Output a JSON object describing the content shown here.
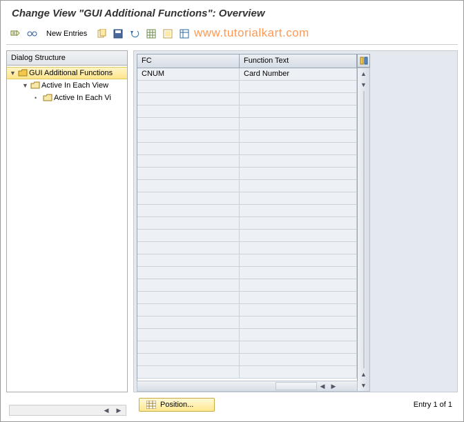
{
  "title": "Change View \"GUI Additional Functions\": Overview",
  "toolbar": {
    "new_entries": "New Entries"
  },
  "watermark": "www.tutorialkart.com",
  "tree": {
    "header": "Dialog Structure",
    "nodes": [
      {
        "label": "GUI Additional Functions",
        "selected": true
      },
      {
        "label": "Active In Each View"
      },
      {
        "label": "Active In Each Vi"
      }
    ]
  },
  "grid": {
    "columns": [
      "FC",
      "Function Text"
    ],
    "rows": [
      {
        "fc": "CNUM",
        "ft": "Card Number"
      }
    ]
  },
  "position_btn": "Position...",
  "status": "Entry 1 of 1",
  "chart_data": {
    "type": "table",
    "columns": [
      "FC",
      "Function Text"
    ],
    "rows": [
      [
        "CNUM",
        "Card Number"
      ]
    ]
  }
}
